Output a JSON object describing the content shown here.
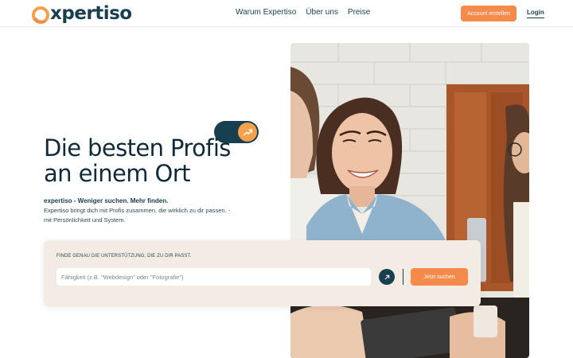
{
  "brand": {
    "name": "xpertiso",
    "accent_color": "#f58b4a",
    "primary_color": "#173f4f"
  },
  "nav": {
    "items": [
      {
        "label": "Warum Expertiso"
      },
      {
        "label": "Über uns"
      },
      {
        "label": "Preise"
      }
    ],
    "account_button": "Account erstellen",
    "login": "Login"
  },
  "hero": {
    "title_line1": "Die besten Profis",
    "title_line2": "an einem Ort",
    "toggle_icon": "trending-up-icon",
    "tagline_bold": "expertiso - Weniger suchen. Mehr finden.",
    "description_line1": "Expertiso bringt dich mit Profis zusammen, die wirklich zu dir passen. -",
    "description_line2": "mit Persönlichkeit und System."
  },
  "search": {
    "label": "FINDE GENAU DIE UNTERSTÜTZUNG, DIE ZU DIR PASST.",
    "placeholder": "Fähigkeit (z.B. \"Webdesign\" oder \"Fotografie\")",
    "arrow_icon": "arrow-up-right-icon",
    "submit_label": "Jetzt suchen"
  },
  "photo": {
    "icon": "people-photo"
  }
}
